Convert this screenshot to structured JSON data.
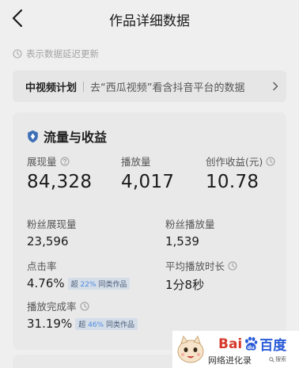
{
  "header": {
    "title": "作品详细数据",
    "back_icon": "chevron-left-icon"
  },
  "notice": {
    "icon": "clock-icon",
    "text": "表示数据延迟更新"
  },
  "plan": {
    "title": "中视频计划",
    "description": "去“西瓜视频”看含抖音平台的数据",
    "chevron_icon": "chevron-right-icon"
  },
  "traffic": {
    "section_icon": "shield-icon",
    "title": "流量与收益",
    "impressions": {
      "label": "展现量",
      "value": "84,328",
      "icon": "question-icon"
    },
    "plays": {
      "label": "播放量",
      "value": "4,017"
    },
    "earnings": {
      "label": "创作收益(元)",
      "value": "10.78",
      "icon": "clock-icon"
    },
    "fan_impressions": {
      "label": "粉丝展现量",
      "value": "23,596"
    },
    "fan_plays": {
      "label": "粉丝播放量",
      "value": "1,539"
    },
    "ctr": {
      "label": "点击率",
      "value": "4.76%",
      "badge_prefix": "超",
      "badge_percent": "22%",
      "badge_suffix": "同类作品"
    },
    "avg_duration": {
      "label": "平均播放时长",
      "value": "1分8秒",
      "icon": "clock-icon"
    },
    "completion": {
      "label": "播放完成率",
      "value": "31.19%",
      "icon": "clock-icon",
      "badge_prefix": "超",
      "badge_percent": "46%",
      "badge_suffix": "同类作品"
    }
  },
  "watermark": {
    "logo_bai": "Bai",
    "logo_du": "du",
    "logo_cn": "百度",
    "caption": "网络进化录",
    "search_label": "搜索",
    "colors": {
      "red": "#d63a2c",
      "blue": "#2a5bd7"
    }
  },
  "colors": {
    "background": "#efefef",
    "card": "#e9e9e9",
    "badge_bg": "#d4dde8",
    "badge_accent": "#4f8de0",
    "section_icon": "#3d6fb7"
  }
}
